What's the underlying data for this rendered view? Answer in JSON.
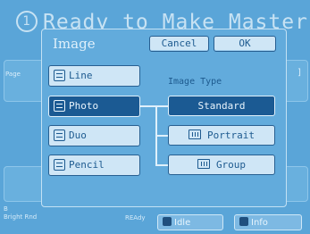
{
  "background": {
    "header_number": "1",
    "header_text": "Ready to Make Master",
    "left_label": "Page",
    "right_label": "]",
    "status_line1": "B",
    "status_line2": "Bright Rnd",
    "ready_text": "REAdy",
    "idle_label": "Idle",
    "info_label": "Info",
    "idle_icon": "grid-icon",
    "info_icon": "info-icon"
  },
  "dialog": {
    "title": "Image",
    "cancel_label": "Cancel",
    "ok_label": "OK",
    "image_modes": [
      {
        "label": "Line",
        "icon": "line-icon",
        "selected": false
      },
      {
        "label": "Photo",
        "icon": "photo-icon",
        "selected": true
      },
      {
        "label": "Duo",
        "icon": "duo-icon",
        "selected": false
      },
      {
        "label": "Pencil",
        "icon": "pencil-icon",
        "selected": false
      }
    ],
    "image_type_label": "Image Type",
    "image_types": [
      {
        "label": "Standard",
        "icon": "",
        "selected": true
      },
      {
        "label": "Portrait",
        "icon": "portrait-icon",
        "selected": false
      },
      {
        "label": "Group",
        "icon": "group-icon",
        "selected": false
      }
    ]
  },
  "colors": {
    "screen_background": "#5aa5d8",
    "button_face": "#cfe6f6",
    "selected_button": "#1b5a93",
    "text_dark": "#1e5b90"
  }
}
